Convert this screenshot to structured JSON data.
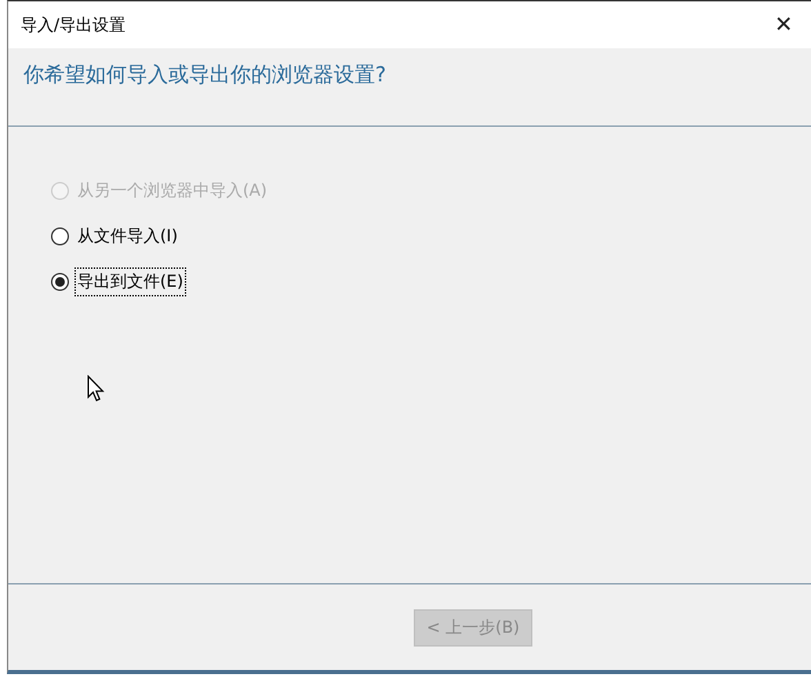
{
  "window": {
    "title": "导入/导出设置",
    "close": "✕"
  },
  "heading": "你希望如何导入或导出你的浏览器设置?",
  "options": [
    {
      "label": "从另一个浏览器中导入(A)",
      "selected": false,
      "disabled": true
    },
    {
      "label": "从文件导入(I)",
      "selected": false,
      "disabled": false
    },
    {
      "label": "导出到文件(E)",
      "selected": true,
      "disabled": false
    }
  ],
  "buttons": [
    {
      "label": "< 上一步(B)",
      "disabled": true
    }
  ]
}
